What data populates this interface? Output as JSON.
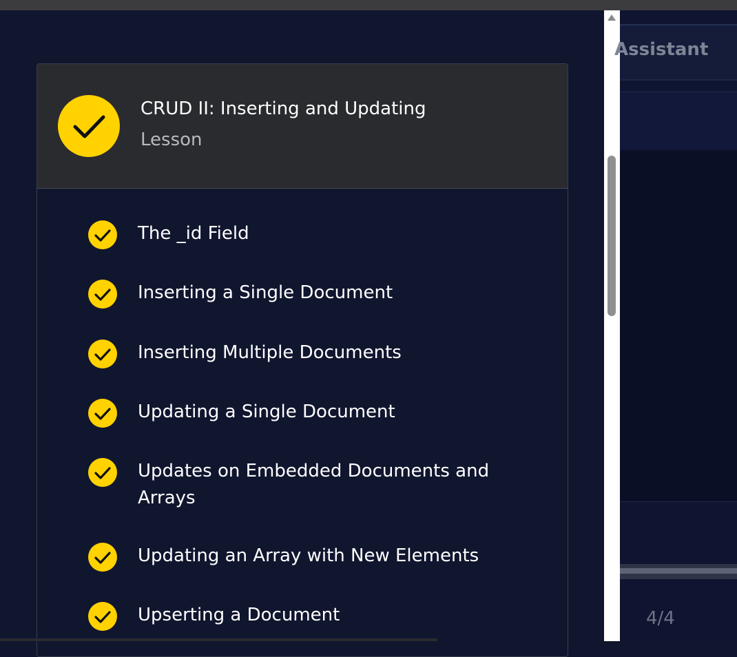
{
  "lesson": {
    "title": "CRUD II: Inserting and Updating",
    "subtitle": "Lesson",
    "status": "completed",
    "accent_color": "#ffd200",
    "items": [
      {
        "label": "The _id Field",
        "status": "completed"
      },
      {
        "label": "Inserting a Single Document",
        "status": "completed"
      },
      {
        "label": "Inserting Multiple Documents",
        "status": "completed"
      },
      {
        "label": "Updating a Single Document",
        "status": "completed"
      },
      {
        "label": "Updates on Embedded Documents and Arrays",
        "status": "completed"
      },
      {
        "label": "Updating an Array with New Elements",
        "status": "completed"
      },
      {
        "label": "Upserting a Document",
        "status": "completed"
      }
    ]
  },
  "right_panel": {
    "tab_label": "Assistant",
    "page_indicator": "4/4"
  }
}
